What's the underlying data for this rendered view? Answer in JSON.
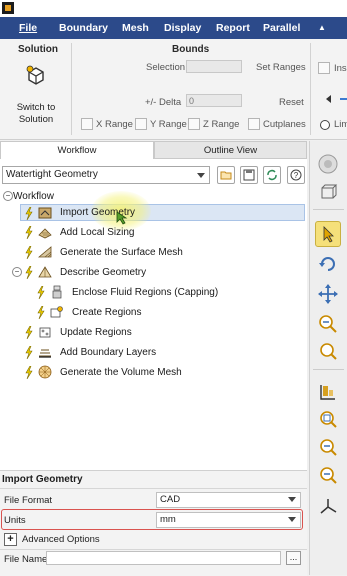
{
  "menubar": {
    "items": [
      "File",
      "Boundary",
      "Mesh",
      "Display",
      "Report",
      "Parallel"
    ],
    "collapse_glyph": "▲"
  },
  "ribbon": {
    "solution": {
      "title": "Solution",
      "button_line1": "Switch to",
      "button_line2": "Solution"
    },
    "bounds": {
      "title": "Bounds",
      "selection_label": "Selection",
      "set_ranges_label": "Set Ranges",
      "delta_label": "+/- Delta",
      "delta_value": "0",
      "reset_label": "Reset",
      "x_range": "X Range",
      "y_range": "Y Range",
      "z_range": "Z Range",
      "cutplanes": "Cutplanes"
    },
    "overflow": {
      "insert_label": "Ins",
      "limit_label": "Lim"
    }
  },
  "tabs": {
    "workflow": "Workflow",
    "outline": "Outline View"
  },
  "workflow_type": "Watertight Geometry",
  "tree": {
    "root": "Workflow",
    "items": [
      {
        "label": "Import Geometry",
        "selected": true
      },
      {
        "label": "Add Local Sizing"
      },
      {
        "label": "Generate the Surface Mesh"
      },
      {
        "label": "Describe Geometry"
      },
      {
        "label": "Enclose Fluid Regions (Capping)"
      },
      {
        "label": "Create Regions"
      },
      {
        "label": "Update Regions"
      },
      {
        "label": "Add Boundary Layers"
      },
      {
        "label": "Generate the Volume Mesh"
      }
    ]
  },
  "props": {
    "title": "Import Geometry",
    "file_format_label": "File Format",
    "file_format_value": "CAD",
    "units_label": "Units",
    "units_value": "mm",
    "advanced_label": "Advanced Options",
    "file_name_label": "File Name",
    "browse_label": "..."
  },
  "colors": {
    "menubar": "#2c4a8a",
    "selection": "#dbe6f4",
    "highlight_glow": "#f4f27a",
    "units_outline": "#d9534f",
    "active_tool": "#f5e07a"
  },
  "right_toolbar_icons": [
    "orbit-icon",
    "view-cube-icon",
    "pointer-icon",
    "rotate-icon",
    "pan-icon",
    "zoom-in-icon",
    "zoom-fit-icon",
    "model-tree-icon",
    "zoom-box-icon",
    "zoom-out-icon",
    "zoom-area-icon",
    "axes-icon"
  ]
}
